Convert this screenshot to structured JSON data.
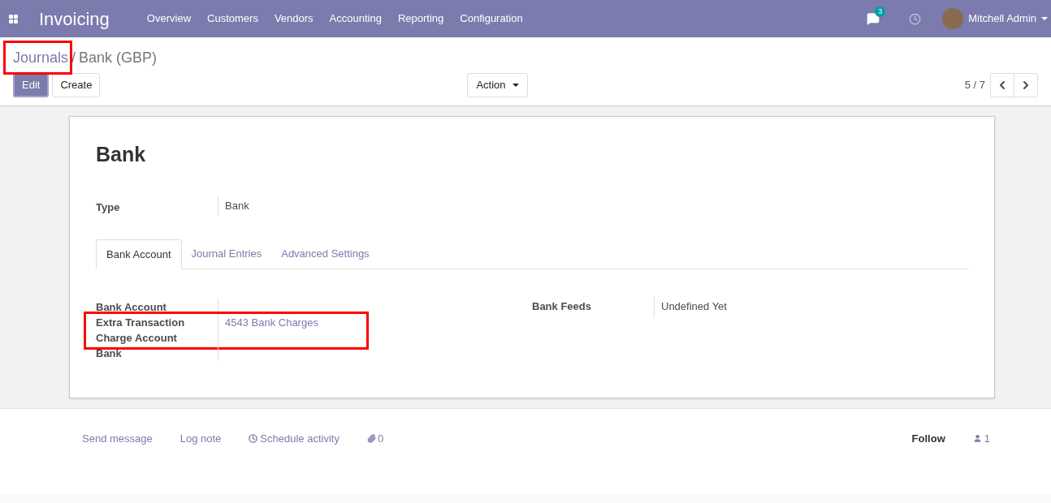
{
  "navbar": {
    "app_title": "Invoicing",
    "menu": [
      "Overview",
      "Customers",
      "Vendors",
      "Accounting",
      "Reporting",
      "Configuration"
    ],
    "messages_badge": "3",
    "user": "Mitchell Admin"
  },
  "breadcrumb": {
    "parent": "Journals",
    "parent_highlighted": true,
    "separator": "/",
    "current": "Bank (GBP)"
  },
  "buttons": {
    "edit": "Edit",
    "create": "Create",
    "action": "Action"
  },
  "pager": {
    "value": "5 / 7"
  },
  "form": {
    "title": "Bank",
    "type_label": "Type",
    "type_value": "Bank",
    "tabs": [
      {
        "label": "Bank Account",
        "selected": true
      },
      {
        "label": "Journal Entries",
        "selected": false
      },
      {
        "label": "Advanced Settings",
        "selected": false
      }
    ],
    "left_fields": [
      {
        "label": "Bank Account",
        "highlighted": false
      },
      {
        "label": "Extra Transaction Charge Account",
        "value": "4543 Bank Charges",
        "highlighted": true
      },
      {
        "label": "Bank",
        "highlighted": false
      }
    ],
    "right_fields": [
      {
        "label": "Bank Feeds",
        "value": "Undefined Yet"
      }
    ]
  },
  "chatter": {
    "send_message": "Send message",
    "log_note": "Log note",
    "schedule_activity": "Schedule activity",
    "attachments": "0",
    "follow": "Follow",
    "followers": "1"
  }
}
